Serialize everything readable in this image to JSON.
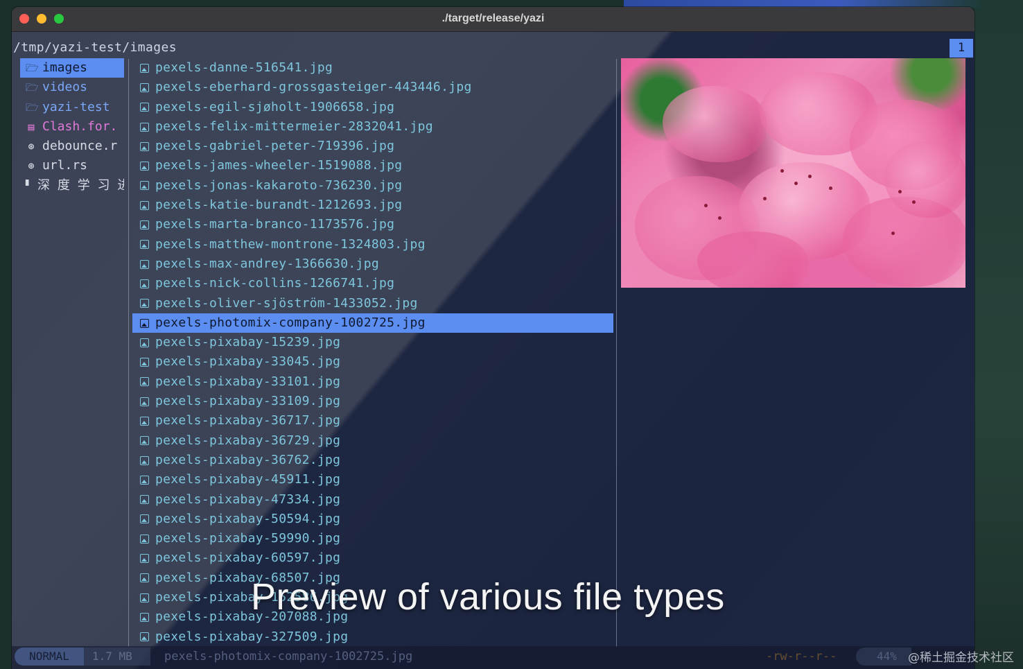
{
  "window": {
    "title": "./target/release/yazi",
    "controls": [
      "close-icon",
      "minimize-icon",
      "zoom-icon"
    ]
  },
  "header": {
    "cwd": "/tmp/yazi-test/images",
    "tab": "1"
  },
  "parent": {
    "items": [
      {
        "label": "images",
        "icon": "folder-icon",
        "icon_glyph": "🗁",
        "active": true
      },
      {
        "label": "videos",
        "icon": "folder-icon",
        "icon_glyph": "🗁"
      },
      {
        "label": "yazi-test",
        "icon": "folder-icon",
        "icon_glyph": "🗁"
      },
      {
        "label": "Clash.for.",
        "icon": "archive-icon",
        "icon_glyph": "▤"
      },
      {
        "label": "debounce.r",
        "icon": "rust-file-icon",
        "icon_glyph": "⊛"
      },
      {
        "label": "url.rs",
        "icon": "rust-file-icon",
        "icon_glyph": "⊛"
      },
      {
        "label": "深 度 学 习 进",
        "icon": "file-icon",
        "icon_glyph": "▘"
      }
    ]
  },
  "files": [
    "pexels-danne-516541.jpg",
    "pexels-eberhard-grossgasteiger-443446.jpg",
    "pexels-egil-sjøholt-1906658.jpg",
    "pexels-felix-mittermeier-2832041.jpg",
    "pexels-gabriel-peter-719396.jpg",
    "pexels-james-wheeler-1519088.jpg",
    "pexels-jonas-kakaroto-736230.jpg",
    "pexels-katie-burandt-1212693.jpg",
    "pexels-marta-branco-1173576.jpg",
    "pexels-matthew-montrone-1324803.jpg",
    "pexels-max-andrey-1366630.jpg",
    "pexels-nick-collins-1266741.jpg",
    "pexels-oliver-sjöström-1433052.jpg",
    "pexels-photomix-company-1002725.jpg",
    "pexels-pixabay-15239.jpg",
    "pexels-pixabay-33045.jpg",
    "pexels-pixabay-33101.jpg",
    "pexels-pixabay-33109.jpg",
    "pexels-pixabay-36717.jpg",
    "pexels-pixabay-36729.jpg",
    "pexels-pixabay-36762.jpg",
    "pexels-pixabay-45911.jpg",
    "pexels-pixabay-47334.jpg",
    "pexels-pixabay-50594.jpg",
    "pexels-pixabay-59990.jpg",
    "pexels-pixabay-60597.jpg",
    "pexels-pixabay-68507.jpg",
    "pexels-pixabay-152586.jpg",
    "pexels-pixabay-207088.jpg",
    "pexels-pixabay-327509.jpg"
  ],
  "selected_index": 13,
  "file_icon": "image-file-icon",
  "caption": "Preview of various file types",
  "status": {
    "mode": "NORMAL",
    "size": "1.7 MB",
    "filename": "pexels-photomix-company-1002725.jpg",
    "permissions": "-rw-r--r--",
    "percent": "44%"
  },
  "watermark": "@稀土掘金技术社区",
  "colors": {
    "accent": "#5b8ef0",
    "file_text": "#7ec6dc",
    "directory": "#7aa7f7",
    "archive": "#e07ad8",
    "background_dark": "#1c2540"
  }
}
